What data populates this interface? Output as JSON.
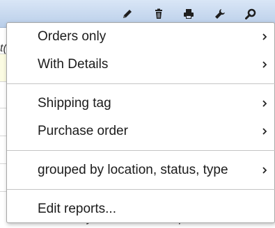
{
  "toolbar": {
    "buttons": [
      {
        "icon": "pencil-icon"
      },
      {
        "icon": "trash-icon"
      },
      {
        "icon": "printer-icon"
      },
      {
        "icon": "wrench-icon"
      },
      {
        "icon": "search-icon"
      }
    ]
  },
  "background": {
    "cut_text": "t(",
    "footer_text": "View system / Sort description -Item"
  },
  "menu": {
    "groups": [
      [
        {
          "label": "Orders only",
          "submenu": true
        },
        {
          "label": "With Details",
          "submenu": true
        }
      ],
      [
        {
          "label": "Shipping tag",
          "submenu": true
        },
        {
          "label": "Purchase order",
          "submenu": true
        }
      ],
      [
        {
          "label": "grouped by location, status, type",
          "submenu": true
        }
      ],
      [
        {
          "label": "Edit reports...",
          "submenu": false
        }
      ]
    ]
  }
}
